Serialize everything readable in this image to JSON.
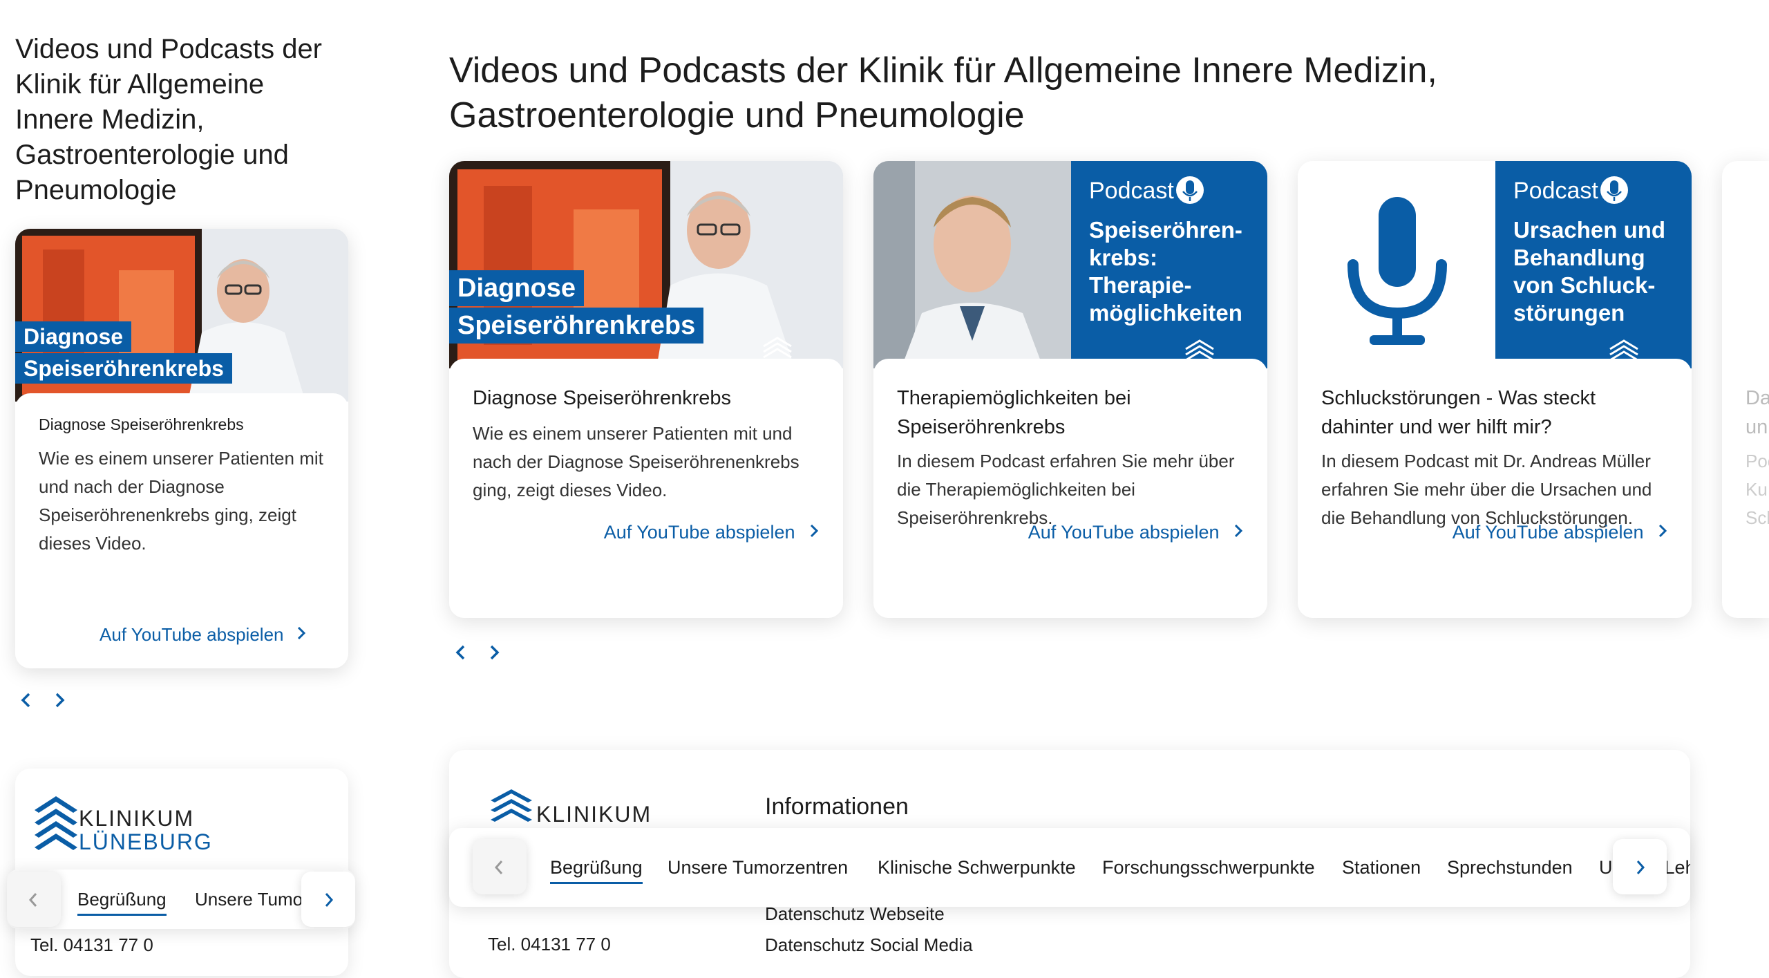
{
  "mobile": {
    "title": "Videos und Podcasts der Klinik für Allgemeine Innere Medizin, Gastroenterologie und Pneumologie",
    "card": {
      "overlay_line1": "Diagnose",
      "overlay_line2": "Speiseröhrenkrebs",
      "title": "Diagnose Speiseröhrenkrebs",
      "description": "Wie es einem unserer Patienten mit und nach der Diagnose Speiseröhrenenkrebs ging, zeigt dieses Video.",
      "link": "Auf YouTube abspielen"
    },
    "logo_line1": "KLINIKUM",
    "logo_line2": "LÜNEBURG",
    "tabs": [
      "Begrüßung",
      "Unsere Tumo"
    ],
    "tel": "Tel. 04131 77 0"
  },
  "desktop": {
    "title": "Videos und Podcasts der Klinik für Allgemeine Innere Medizin, Gastroenterologie und Pneumologie",
    "cards": [
      {
        "overlay_line1": "Diagnose",
        "overlay_line2": "Speiseröhrenkrebs",
        "title": "Diagnose Speiseröhrenkrebs",
        "description": "Wie es einem unserer Patienten mit und nach der Diagnose Speiseröhrenenkrebs ging, zeigt dieses Video.",
        "link": "Auf YouTube abspielen"
      },
      {
        "podcast_label": "Podcast",
        "podcast_heading": "Speiseröhren-\nkrebs:\nTherapie-\nmöglichkeiten",
        "title": "Therapiemöglichkeiten bei Speiseröhrenkrebs",
        "description": "In diesem Podcast erfahren Sie mehr über die Therapiemöglichkeiten bei Speiseröhrenkrebs.",
        "link": "Auf YouTube abspielen"
      },
      {
        "podcast_label": "Podcast",
        "podcast_heading": "Ursachen und\nBehandlung\nvon Schluck-\nstörungen",
        "title": "Schluckstörungen - Was steckt dahinter und wer hilft mir?",
        "description": "In diesem Podcast mit Dr. Andreas Müller erfahren Sie mehr über die Ursachen und die Behandlung von Schluckstörungen.",
        "link": "Auf YouTube abspielen"
      }
    ],
    "partial_card": {
      "title_fragment": "Da\nun",
      "desc_fragment": "Poc\nKu\nSch"
    },
    "logo_text": "KLINIKUM",
    "info_title": "Informationen",
    "info_links": [
      "Datenschutz Webseite",
      "Datenschutz Social Media"
    ],
    "tel": "Tel. 04131 77 0",
    "tabs": [
      "Begrüßung",
      "Unsere Tumorzentren",
      "Klinische Schwerpunkte",
      "Forschungsschwerpunkte",
      "Stationen",
      "Sprechstunden",
      "Unsere Lehre"
    ],
    "logo_brand": "KLINIKUM"
  },
  "colors": {
    "brand_blue": "#0a5da6",
    "text": "#1c1c1c"
  }
}
